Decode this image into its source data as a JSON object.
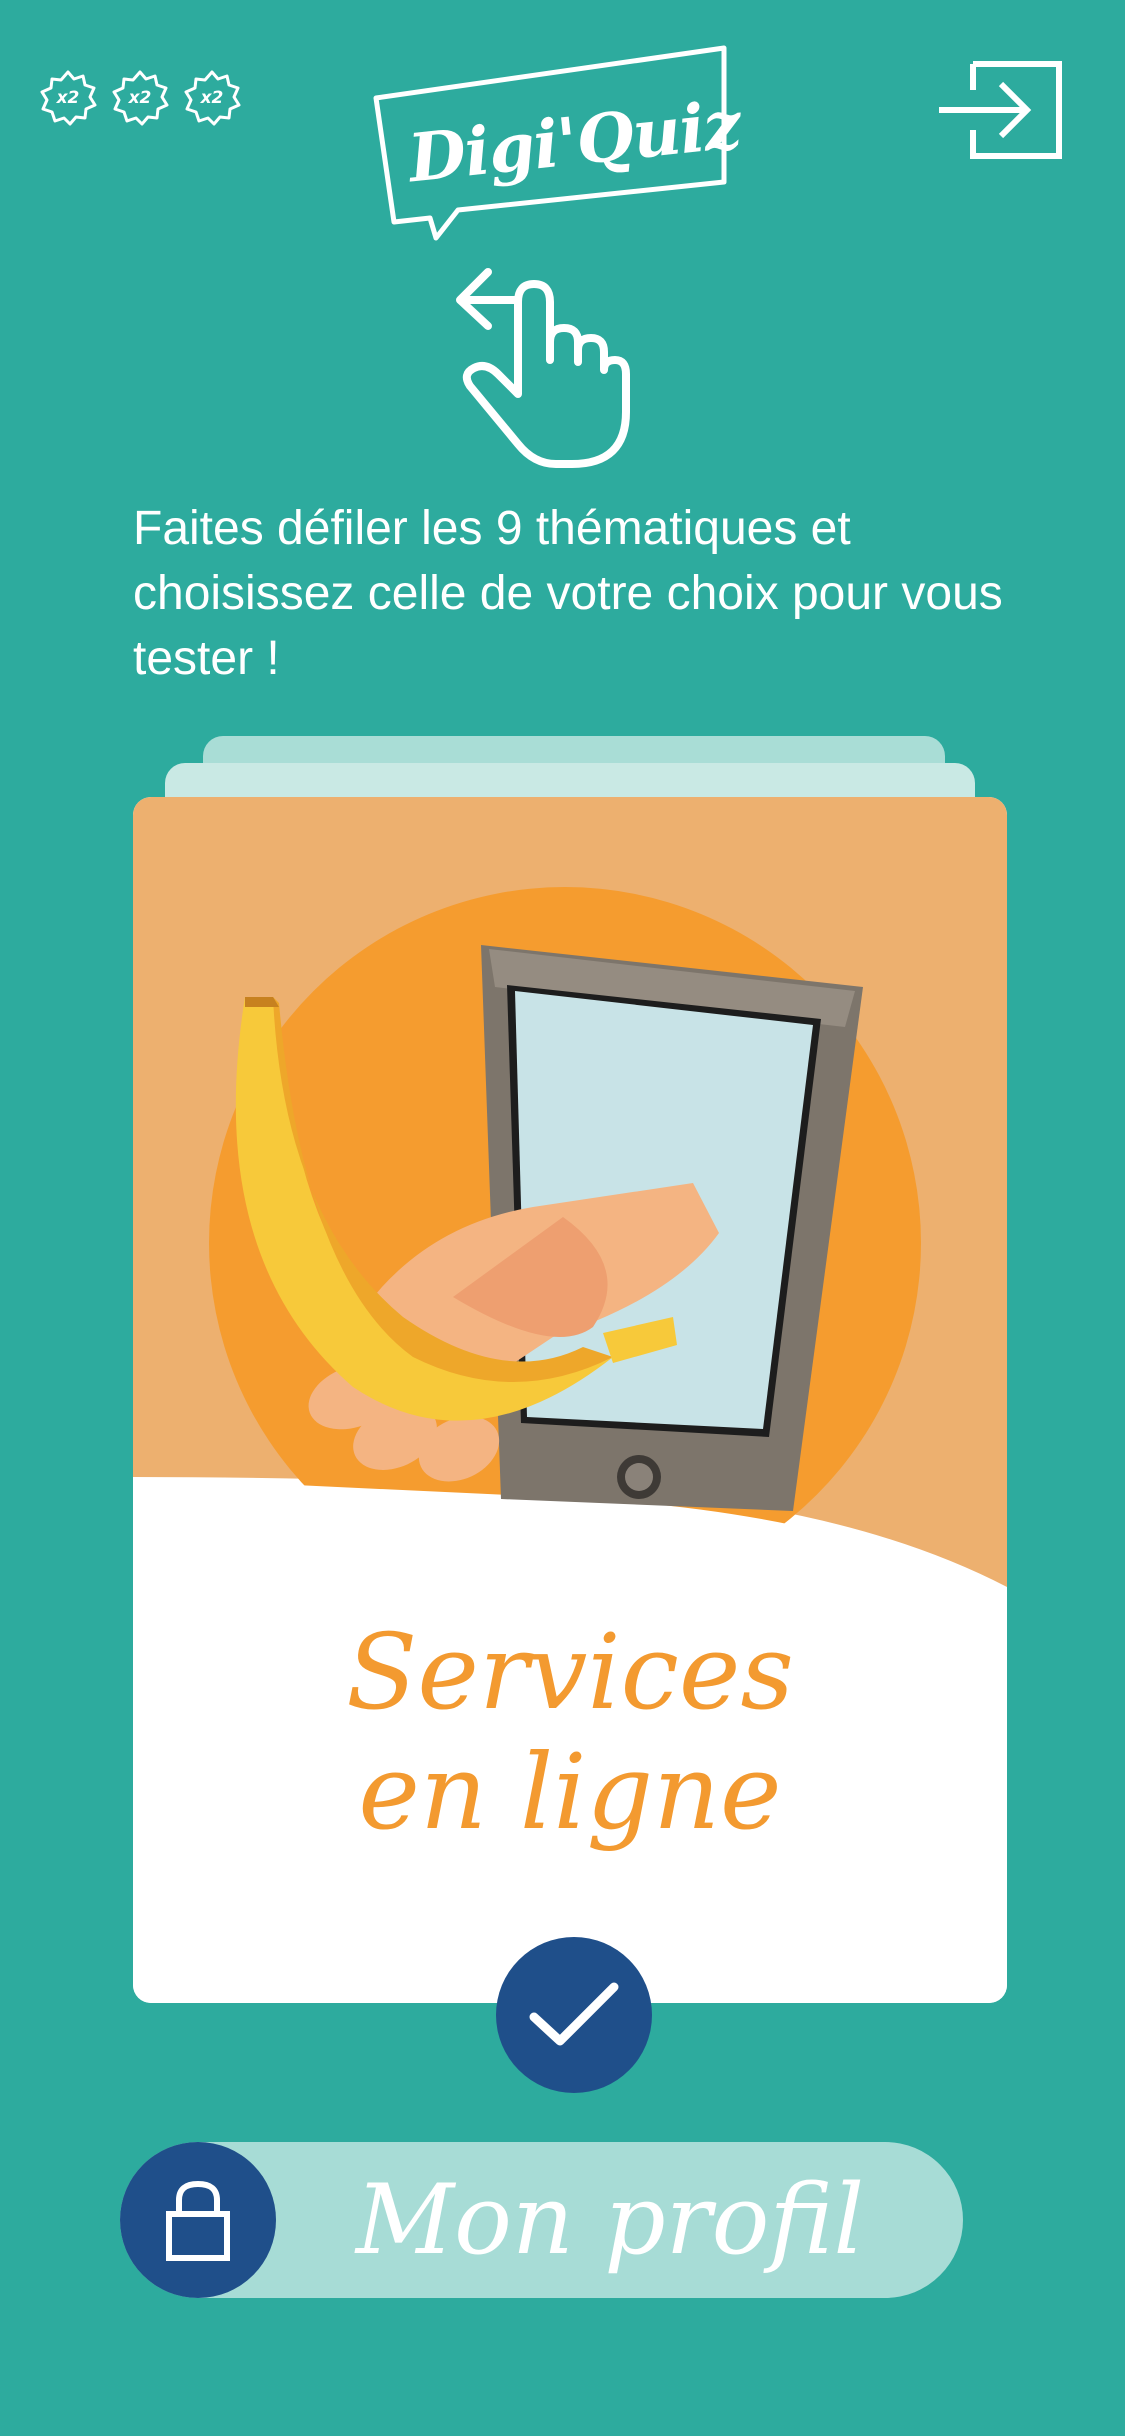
{
  "app": {
    "logo_text": "Digi'Quiz"
  },
  "header": {
    "badges": [
      {
        "label": "x2",
        "icon": "flower-badge-icon"
      },
      {
        "label": "x2",
        "icon": "flower-badge-icon"
      },
      {
        "label": "x2",
        "icon": "flower-badge-icon"
      }
    ],
    "logout_icon": "logout-arrow-icon"
  },
  "instruction": {
    "icon": "swipe-left-hand-icon",
    "text": "Faites défiler les 9 thématiques et choisissez celle de votre choix pour vous tester !"
  },
  "theme_card": {
    "title_line1": "Services",
    "title_line2": "en ligne",
    "illustration": "hand-with-banana-through-tablet",
    "confirm_icon": "checkmark-icon"
  },
  "profile": {
    "label": "Mon profil",
    "lock_icon": "padlock-icon"
  },
  "colors": {
    "background": "#2dab9e",
    "accent_orange": "#f39a30",
    "button_blue": "#1f4f8a",
    "profile_bar": "#a7dcd6"
  }
}
